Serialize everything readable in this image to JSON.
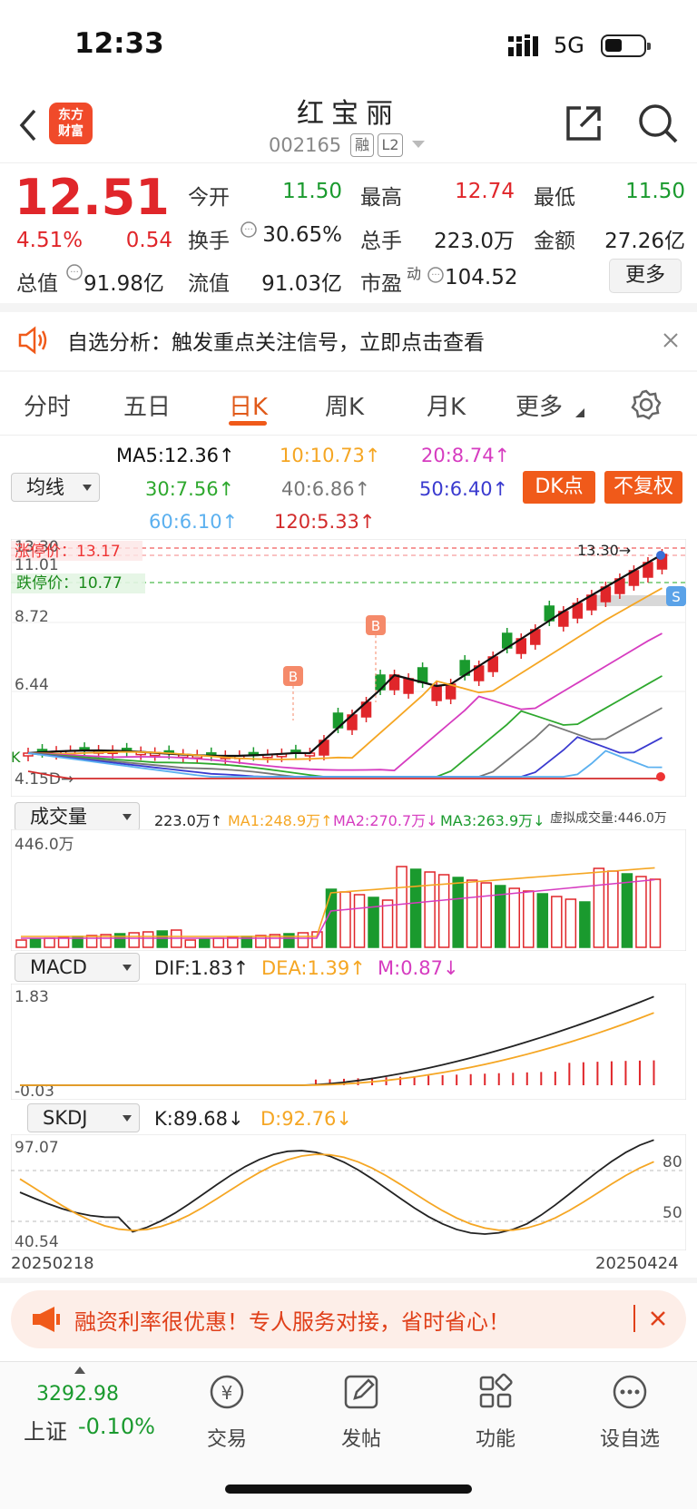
{
  "status": {
    "time": "12:33",
    "network": "5G"
  },
  "header": {
    "logo": "东方\n财富",
    "name": "红宝丽",
    "code": "002165",
    "tag1": "融",
    "tag2": "L2"
  },
  "quote": {
    "price": "12.51",
    "change_pct": "4.51%",
    "change": "0.54",
    "open_label": "今开",
    "open": "11.50",
    "high_label": "最高",
    "high": "12.74",
    "low_label": "最低",
    "low": "11.50",
    "turnover_label": "换手",
    "turnover": "30.65%",
    "volume_label": "总手",
    "volume": "223.0万",
    "amount_label": "金额",
    "amount": "27.26亿",
    "mcap_label": "总值",
    "mcap": "91.98亿",
    "float_label": "流值",
    "float": "91.03亿",
    "pe_label": "市盈",
    "pe_sup": "动",
    "pe": "104.52",
    "more": "更多"
  },
  "notice": {
    "text": "自选分析：触发重点关注信号，立即点击查看"
  },
  "tabs": [
    "分时",
    "五日",
    "日K",
    "周K",
    "月K",
    "更多"
  ],
  "ma": {
    "ma5": "MA5:12.36↑",
    "ma10": "10:10.73↑",
    "ma20": "20:8.74↑",
    "ma30": "30:7.56↑",
    "ma40": "40:6.86↑",
    "ma50": "50:6.40↑",
    "ma60": "60:6.10↑",
    "ma120": "120:5.33↑",
    "select": "均线",
    "dk": "DK点",
    "fq": "不复权"
  },
  "kchart": {
    "limit_up": "涨停价：13.17",
    "limit_down": "跌停价：10.77",
    "y1": "13.30",
    "y2": "11.01",
    "y3": "8.72",
    "y4": "6.44",
    "y5": "4.15",
    "max_label": "13.30→",
    "low_label": "4.15D→",
    "b_marker": "B",
    "s_marker": "S",
    "k_label": "K",
    "colors": {
      "up": "#e0262a",
      "down": "#1a9a2e",
      "ma5": "#111111",
      "ma10": "#f5a623",
      "ma20": "#d63cc0",
      "ma30": "#2ea82e",
      "ma40": "#777777",
      "ma50": "#3a3acf",
      "ma60": "#5bb0ef",
      "ma120": "#d22b2b"
    }
  },
  "volume": {
    "select": "成交量",
    "info": "223.0万↑",
    "ma1": "MA1:248.9万↑",
    "ma2": "MA2:270.7万↓",
    "ma3": "MA3:263.9万↓",
    "virtual": "虚拟成交量:446.0万",
    "ymax": "446.0万"
  },
  "macd": {
    "select": "MACD",
    "dif": "DIF:1.83↑",
    "dea": "DEA:1.39↑",
    "m": "M:0.87↓",
    "ymax": "1.83",
    "ymin": "-0.03"
  },
  "skdj": {
    "select": "SKDJ",
    "k": "K:89.68↓",
    "d": "D:92.76↓",
    "ymax": "97.07",
    "ymin": "40.54",
    "l80": "80",
    "l50": "50"
  },
  "dates": {
    "start": "20250218",
    "end": "20250424"
  },
  "promo": {
    "text": "融资利率很优惠！专人服务对接，省时省心！"
  },
  "bottom": {
    "index_value": "3292.98",
    "index_name": "上证",
    "index_change": "-0.10%",
    "items": [
      "交易",
      "发帖",
      "功能",
      "设自选"
    ]
  }
}
